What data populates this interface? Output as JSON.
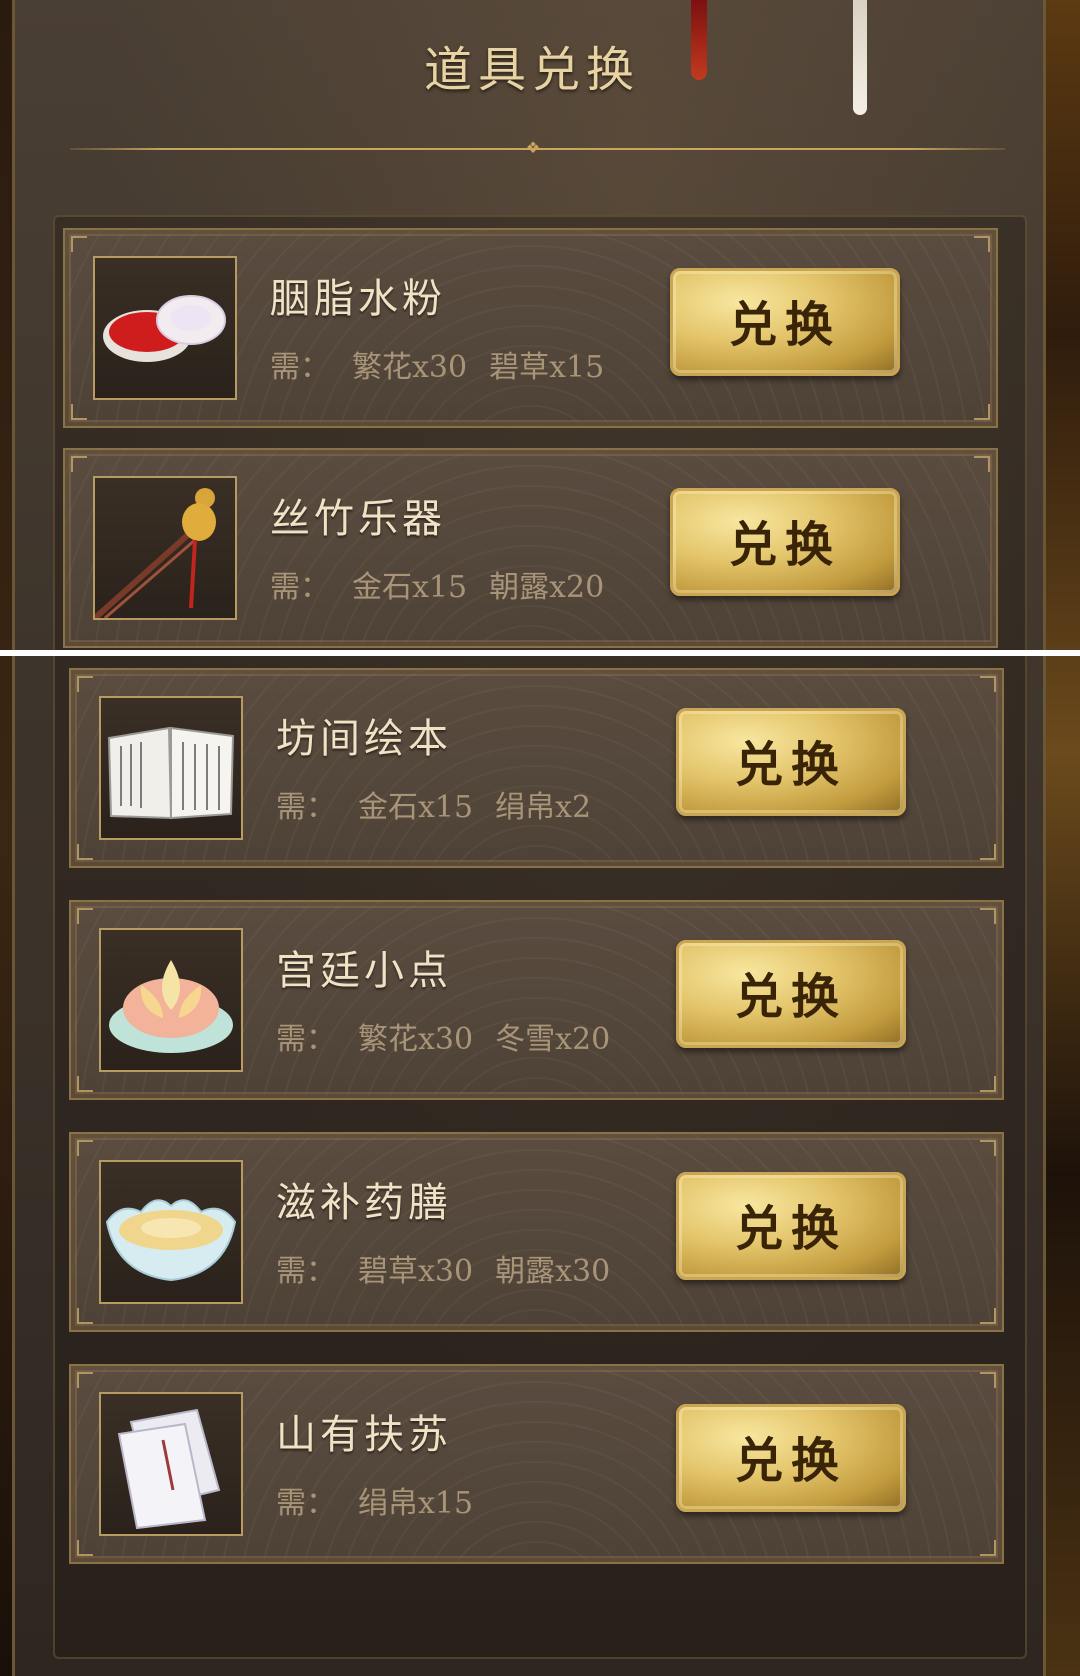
{
  "header": {
    "title": "道具兑换"
  },
  "items": [
    {
      "name": "胭脂水粉",
      "requirement_prefix": "需：",
      "requirements": [
        "繁花x30",
        "碧草x15"
      ],
      "button_label": "兑换",
      "icon": "rouge-compact-icon"
    },
    {
      "name": "丝竹乐器",
      "requirement_prefix": "需：",
      "requirements": [
        "金石x15",
        "朝露x20"
      ],
      "button_label": "兑换",
      "icon": "gourd-flute-icon"
    },
    {
      "name": "坊间绘本",
      "requirement_prefix": "需：",
      "requirements": [
        "金石x15",
        "绢帛x2"
      ],
      "button_label": "兑换",
      "icon": "open-book-icon"
    },
    {
      "name": "宫廷小点",
      "requirement_prefix": "需：",
      "requirements": [
        "繁花x30",
        "冬雪x20"
      ],
      "button_label": "兑换",
      "icon": "lotus-pastry-icon"
    },
    {
      "name": "滋补药膳",
      "requirement_prefix": "需：",
      "requirements": [
        "碧草x30",
        "朝露x30"
      ],
      "button_label": "兑换",
      "icon": "soup-bowl-icon"
    },
    {
      "name": "山有扶苏",
      "requirement_prefix": "需：",
      "requirements": [
        "绢帛x15"
      ],
      "button_label": "兑换",
      "icon": "stationery-book-icon"
    }
  ],
  "colors": {
    "title": "#e9d3a3",
    "item_name": "#f0e2c4",
    "requirement": "#a89477",
    "button_gold": "#e3c46a",
    "button_text": "#3a2408",
    "rouge_red": "#d11f1f"
  }
}
